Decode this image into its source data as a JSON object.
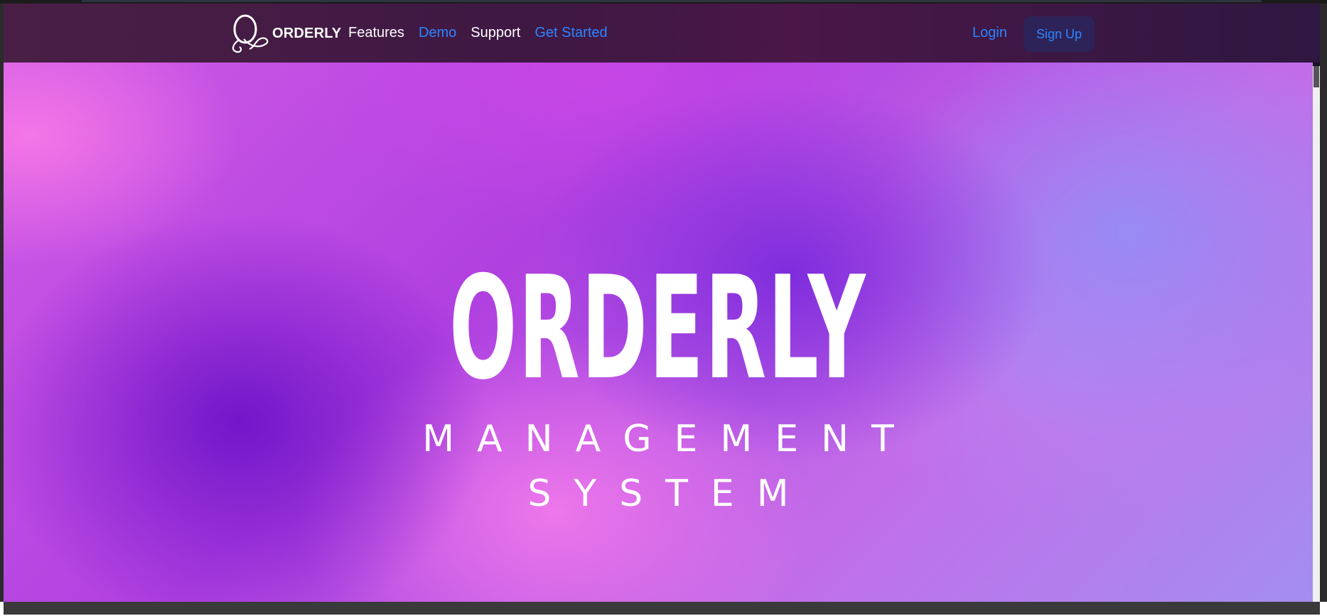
{
  "nav": {
    "brand_name": "ORDERLY",
    "logo_icon": "orderly-logo-icon",
    "links": [
      {
        "label": "Features",
        "color": "#ffffff"
      },
      {
        "label": "Demo",
        "color": "#2a86ff"
      },
      {
        "label": "Support",
        "color": "#ffffff"
      },
      {
        "label": "Get Started",
        "color": "#2a86ff"
      }
    ],
    "login_label": "Login",
    "signup_label": "Sign Up"
  },
  "hero": {
    "title": "ORDERLY",
    "subtitle_line1": "MANAGEMENT",
    "subtitle_line2": "SYSTEM"
  },
  "colors": {
    "navbar_bg": "#3e1843",
    "link_accent": "#2a86ff",
    "signup_bg": "#2e2358",
    "hero_purple": "#b040e0",
    "hero_pink": "#f078eb",
    "hero_lavender": "#968cf5"
  }
}
